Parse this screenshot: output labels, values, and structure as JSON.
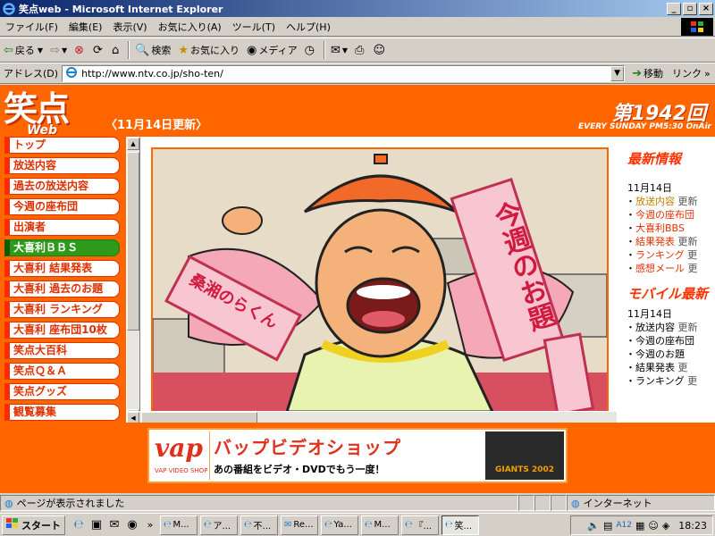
{
  "window": {
    "title": "笑点web - Microsoft Internet Explorer"
  },
  "menu": [
    "ファイル(F)",
    "編集(E)",
    "表示(V)",
    "お気に入り(A)",
    "ツール(T)",
    "ヘルプ(H)"
  ],
  "toolbar": {
    "back": "戻る",
    "search": "検索",
    "favorites": "お気に入り",
    "media": "メディア"
  },
  "address": {
    "label": "アドレス(D)",
    "url": "http://www.ntv.co.jp/sho-ten/",
    "go": "移動",
    "links": "リンク"
  },
  "site": {
    "logo": "笑点",
    "logo_web": "Web",
    "updated": "〈11月14日更新〉",
    "episode": "第1942回",
    "onair": "EVERY SUNDAY PM5:30 OnAir",
    "nav": [
      "トップ",
      "放送内容",
      "過去の放送内容",
      "今週の座布団",
      "出演者",
      "大喜利ＢＢＳ",
      "大喜利 結果発表",
      "大喜利 過去のお題",
      "大喜利 ランキング",
      "大喜利 座布団10枚",
      "笑点大百科",
      "笑点Ｑ＆Ａ",
      "笑点グッズ",
      "観覧募集"
    ],
    "nav_active": 5,
    "illustration": {
      "banner_right": "今週のお題",
      "banner_left": "桑湘のらくん"
    },
    "news": {
      "title": "最新情報",
      "date": "11月14日",
      "items": [
        {
          "text": "放送内容",
          "suffix": "更新"
        },
        {
          "text": "今週の座布団",
          "suffix": ""
        },
        {
          "text": "大喜利BBS",
          "suffix": ""
        },
        {
          "text": "結果発表",
          "suffix": "更新"
        },
        {
          "text": "ランキング",
          "suffix": "更"
        },
        {
          "text": "感想メール",
          "suffix": "更"
        }
      ],
      "mobile_title": "モバイル最新",
      "mobile_date": "11月14日",
      "mobile_items": [
        {
          "text": "放送内容",
          "suffix": "更新"
        },
        {
          "text": "今週の座布団",
          "suffix": ""
        },
        {
          "text": "今週のお題",
          "suffix": ""
        },
        {
          "text": "結果発表",
          "suffix": "更"
        },
        {
          "text": "ランキング",
          "suffix": "更"
        }
      ]
    },
    "banner": {
      "vap": "vap",
      "vap_sub": "VAP VIDEO SHOP",
      "shop": "バップビデオショップ",
      "tagline": "あの番組をビデオ・DVDでもう一度！",
      "giants": "GIANTS 2002"
    }
  },
  "status": {
    "text": "ページが表示されました",
    "zone": "インターネット"
  },
  "taskbar": {
    "start": "スタート",
    "buttons": [
      "M...",
      "ア...",
      "不...",
      "Re...",
      "Ya...",
      "M...",
      "『...",
      "笑..."
    ],
    "active": 7,
    "clock": "18:23"
  }
}
